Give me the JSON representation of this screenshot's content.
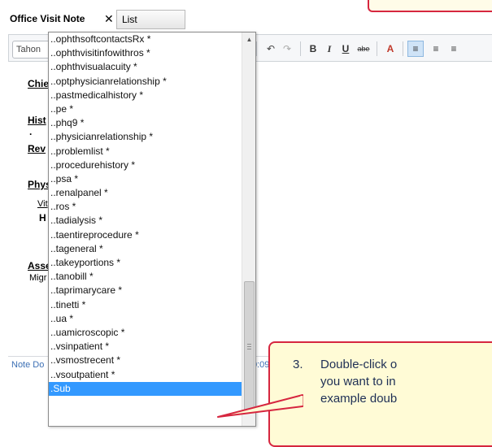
{
  "tabs": [
    {
      "label": "Office Visit Note",
      "close": "✕"
    },
    {
      "label": "List"
    }
  ],
  "toolbar": {
    "template_prefix": "Tahon",
    "undo": "↶",
    "redo": "↷",
    "bold": "B",
    "italic": "I",
    "underline": "U",
    "strike": "abe",
    "font_color": "A",
    "align_left": "≡",
    "align_center": "≡",
    "align_right": "≡"
  },
  "document": {
    "chief": "Chie",
    "history": "Hist",
    "dot": "·",
    "review": "Rev",
    "physical": "Phys",
    "vitals": "Vit",
    "ht": "H",
    "assessment": "Asse",
    "migraine": "Migr"
  },
  "status_bar": {
    "left": "Note Do",
    "right": "0:09, Office"
  },
  "dropdown": {
    "items": [
      "..ophthsoftcontactsRx *",
      "..ophthvisitinfowithros *",
      "..ophthvisualacuity *",
      "..optphysicianrelationship *",
      "..pastmedicalhistory *",
      "..pe *",
      "..phq9 *",
      "..physicianrelationship *",
      "..problemlist *",
      "..procedurehistory *",
      "..psa *",
      "..renalpanel *",
      "..ros *",
      "..tadialysis *",
      "..taentireprocedure *",
      "..tageneral *",
      "..takeyportions *",
      "..tanobill *",
      "..taprimarycare *",
      "..tinetti *",
      "..ua *",
      "..uamicroscopic *",
      "..vsinpatient *",
      "..vsmostrecent *",
      "..vsoutpatient *",
      ".Sub"
    ],
    "selected_index": 25
  },
  "callout": {
    "number": "3.",
    "line1": "Double-click o",
    "line2": "you want to in",
    "line3": "example doub"
  },
  "colors": {
    "callout_border": "#d6263f",
    "callout_fill": "#fffbd6",
    "selection": "#3399ff"
  }
}
